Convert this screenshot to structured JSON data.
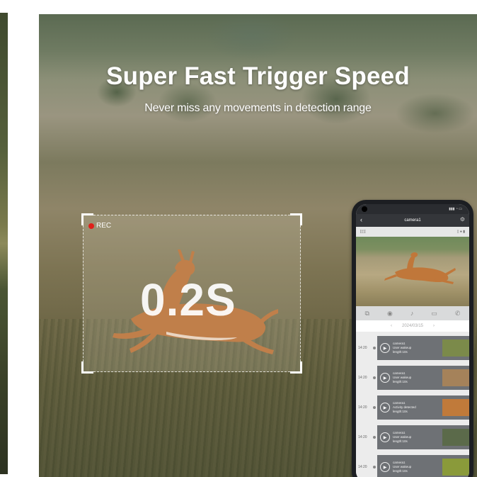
{
  "headline": {
    "title": "Super Fast Trigger Speed",
    "subtitle": "Never miss any movements in detection range"
  },
  "frame": {
    "rec_label": "REC",
    "trigger_value": "0.2S"
  },
  "phone": {
    "nav_title": "camera1",
    "date_label": "2024/03/15",
    "events": [
      {
        "time": "14:20",
        "line1": "camera1",
        "line2": "User wakeup",
        "line3": "length:10s",
        "thumb": "#7b8a4a"
      },
      {
        "time": "14:20",
        "line1": "camera1",
        "line2": "User wakeup",
        "line3": "length:10s",
        "thumb": "#a5825a"
      },
      {
        "time": "14:20",
        "line1": "camera1",
        "line2": "Activity detected",
        "line3": "length:10s",
        "thumb": "#c07a3a"
      },
      {
        "time": "14:20",
        "line1": "camera1",
        "line2": "User wakeup",
        "line3": "length:10s",
        "thumb": "#5b6a4a"
      },
      {
        "time": "14:20",
        "line1": "camera1",
        "line2": "User wakeup",
        "line3": "length:10s",
        "thumb": "#8a9a3a"
      }
    ]
  },
  "colors": {
    "rec_dot": "#e0201a",
    "deer": "#b86a2e"
  }
}
